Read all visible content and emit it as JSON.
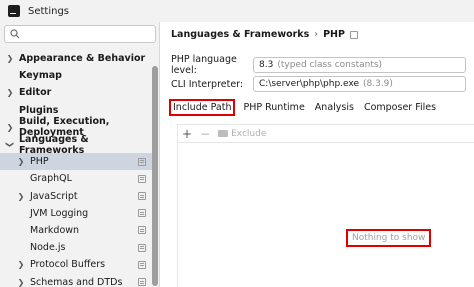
{
  "window": {
    "title": "Settings"
  },
  "search": {
    "placeholder": ""
  },
  "sidebar": {
    "items": [
      {
        "label": "Appearance & Behavior",
        "level": 0,
        "chevron": "right"
      },
      {
        "label": "Keymap",
        "level": 0,
        "chevron": ""
      },
      {
        "label": "Editor",
        "level": 0,
        "chevron": "right"
      },
      {
        "label": "Plugins",
        "level": 0,
        "chevron": ""
      },
      {
        "label": "Build, Execution, Deployment",
        "level": 0,
        "chevron": "right"
      },
      {
        "label": "Languages & Frameworks",
        "level": 0,
        "chevron": "down"
      },
      {
        "label": "PHP",
        "level": 1,
        "chevron": "right",
        "selected": true,
        "pinned": true
      },
      {
        "label": "GraphQL",
        "level": 1,
        "chevron": "",
        "pinned": true
      },
      {
        "label": "JavaScript",
        "level": 1,
        "chevron": "right",
        "pinned": true
      },
      {
        "label": "JVM Logging",
        "level": 1,
        "chevron": "",
        "pinned": true
      },
      {
        "label": "Markdown",
        "level": 1,
        "chevron": "",
        "pinned": true
      },
      {
        "label": "Node.js",
        "level": 1,
        "chevron": "",
        "pinned": true
      },
      {
        "label": "Protocol Buffers",
        "level": 1,
        "chevron": "right",
        "pinned": true
      },
      {
        "label": "Schemas and DTDs",
        "level": 1,
        "chevron": "right",
        "pinned": true
      }
    ]
  },
  "breadcrumb": {
    "parent": "Languages & Frameworks",
    "separator": "›",
    "current": "PHP"
  },
  "fields": {
    "language_level": {
      "label": "PHP language level:",
      "value": "8.3",
      "hint": "(typed class constants)"
    },
    "cli_interpreter": {
      "label": "CLI Interpreter:",
      "value": "C:\\server\\php\\php.exe",
      "hint": "(8.3.9)"
    }
  },
  "tabs": [
    {
      "label": "Include Path",
      "active": true
    },
    {
      "label": "PHP Runtime",
      "active": false
    },
    {
      "label": "Analysis",
      "active": false
    },
    {
      "label": "Composer Files",
      "active": false
    }
  ],
  "toolbar": {
    "add": "+",
    "remove": "−",
    "exclude": "Exclude"
  },
  "panel": {
    "empty_text": "Nothing to show"
  },
  "colors": {
    "highlight": "#e00000",
    "selection": "#cdd5e0",
    "sidebar_bg": "#f2f2f2"
  }
}
